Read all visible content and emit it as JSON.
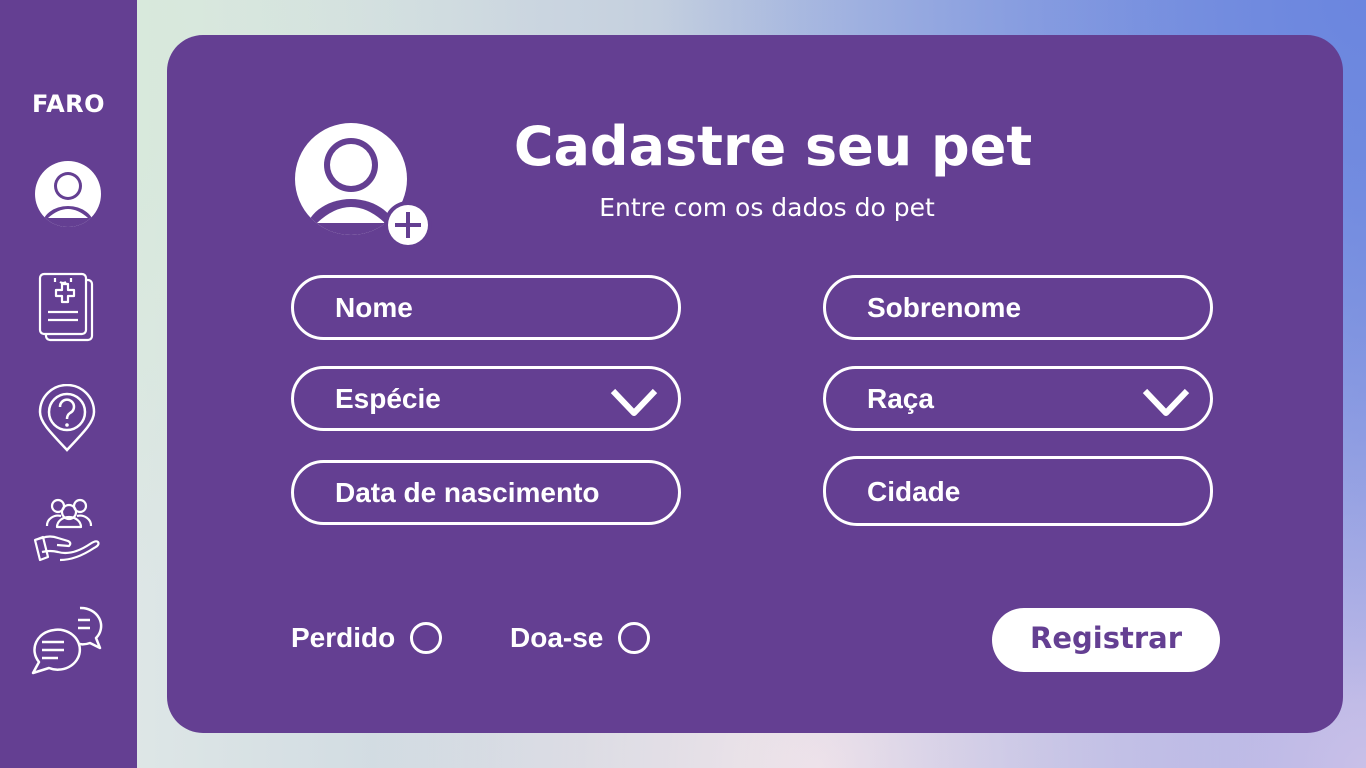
{
  "sidebar": {
    "brand": "FARO",
    "items": [
      {
        "icon": "user-circle-icon"
      },
      {
        "icon": "medical-records-icon"
      },
      {
        "icon": "help-location-icon"
      },
      {
        "icon": "community-hand-icon"
      },
      {
        "icon": "chat-bubbles-icon"
      }
    ]
  },
  "form": {
    "title": "Cadastre seu pet",
    "subtitle": "Entre com os dados do pet",
    "avatar_icon": "add-user-icon",
    "fields": {
      "nome": "Nome",
      "sobrenome": "Sobrenome",
      "especie": "Espécie",
      "raca": "Raça",
      "data_nascimento": "Data de nascimento",
      "cidade": "Cidade"
    },
    "options": {
      "perdido": "Perdido",
      "doase": "Doa-se"
    },
    "register_label": "Registrar"
  },
  "colors": {
    "purple": "#643f92",
    "white": "#ffffff"
  }
}
